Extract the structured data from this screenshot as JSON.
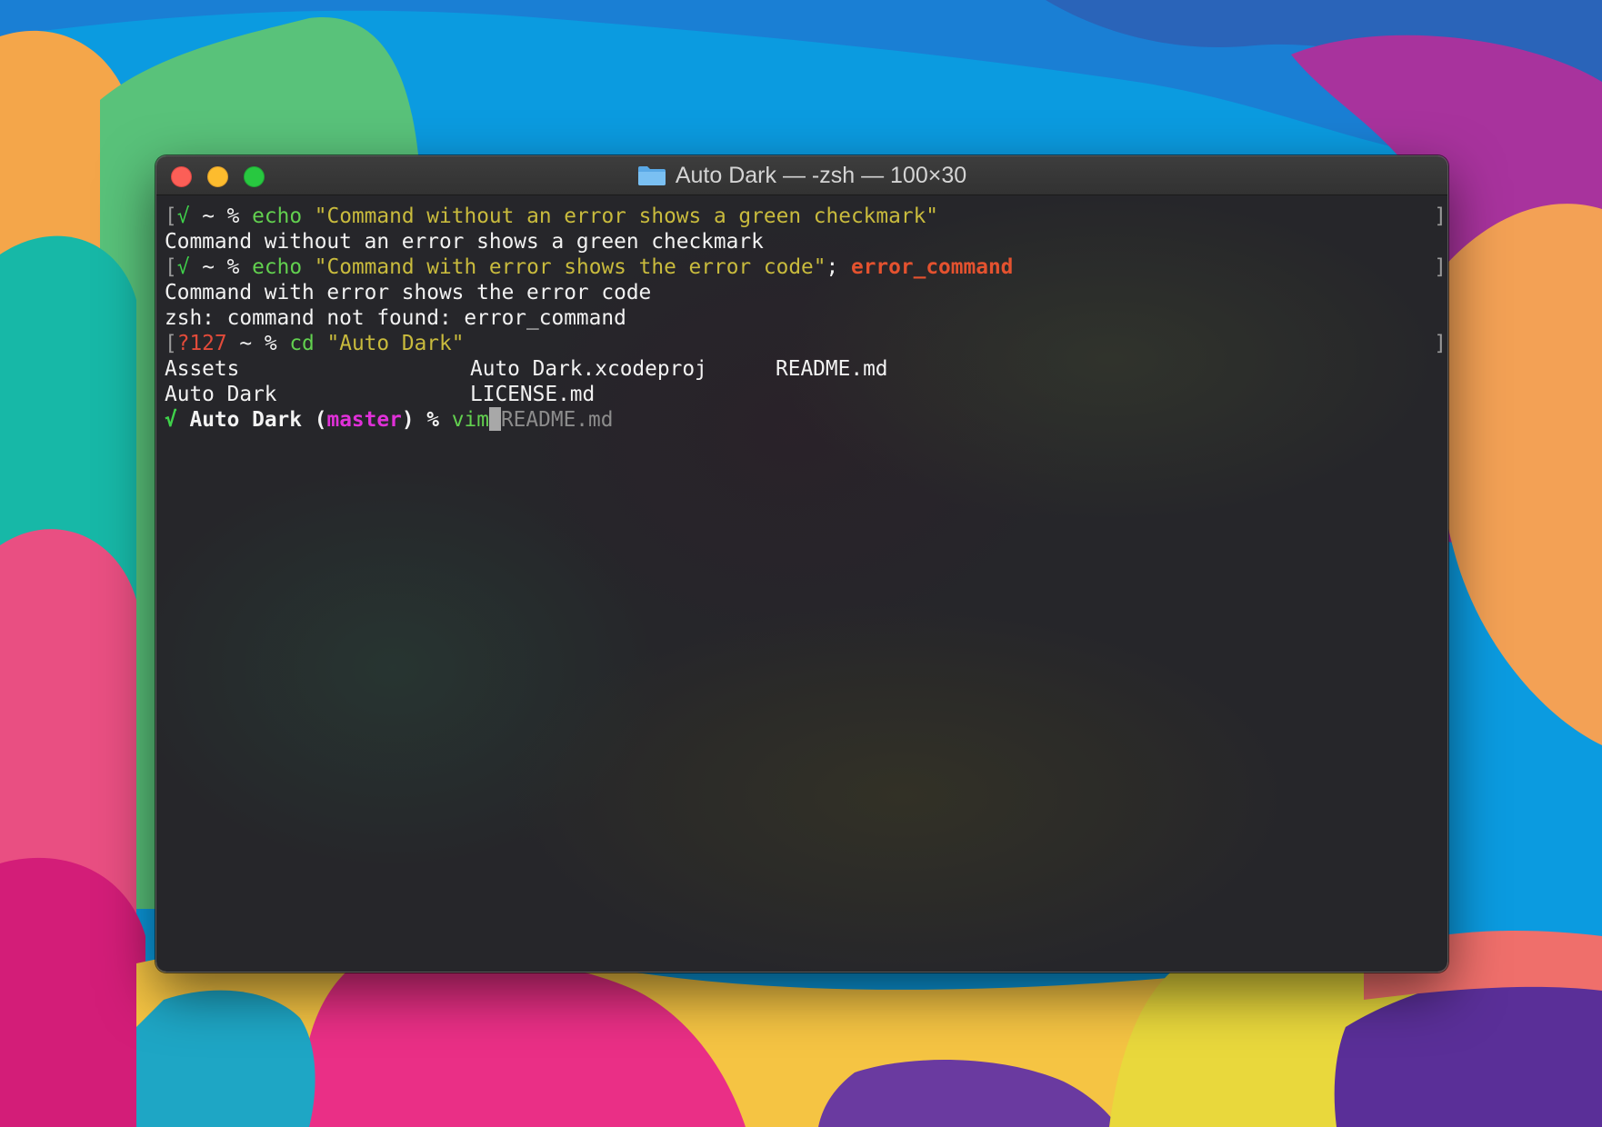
{
  "window": {
    "title": "Auto Dark — -zsh — 100×30",
    "folder_icon": "folder-icon"
  },
  "colors": {
    "success": "#3fd14a",
    "error": "#e24b3a",
    "command": "#62d04f",
    "string": "#c9bb3d",
    "branch": "#e030d8",
    "suggestion": "#8c8c8c"
  },
  "terminal": {
    "line1": {
      "status": "√",
      "dir": "~",
      "prompt": "%",
      "cmd": "echo",
      "arg": "\"Command without an error shows a green checkmark\""
    },
    "line2": {
      "output": "Command without an error shows a green checkmark"
    },
    "line3": {
      "status": "√",
      "dir": "~",
      "prompt": "%",
      "cmd": "echo",
      "arg": "\"Command with error shows the error code\"",
      "sep": ";",
      "errcmd": "error_command"
    },
    "line4": {
      "output": "Command with error shows the error code"
    },
    "line5": {
      "output": "zsh: command not found: error_command"
    },
    "line6": {
      "status": "?127",
      "dir": "~",
      "prompt": "%",
      "cmd": "cd",
      "arg": "\"Auto Dark\""
    },
    "listing": [
      [
        "Assets",
        "Auto Dark.xcodeproj",
        "README.md"
      ],
      [
        "Auto Dark",
        "LICENSE.md",
        ""
      ]
    ],
    "line9": {
      "status": "√",
      "dir": "Auto Dark",
      "paren_open": "(",
      "branch": "master",
      "paren_close": ")",
      "prompt": "%",
      "cmd": "vim",
      "suggestion": "README.md"
    }
  }
}
